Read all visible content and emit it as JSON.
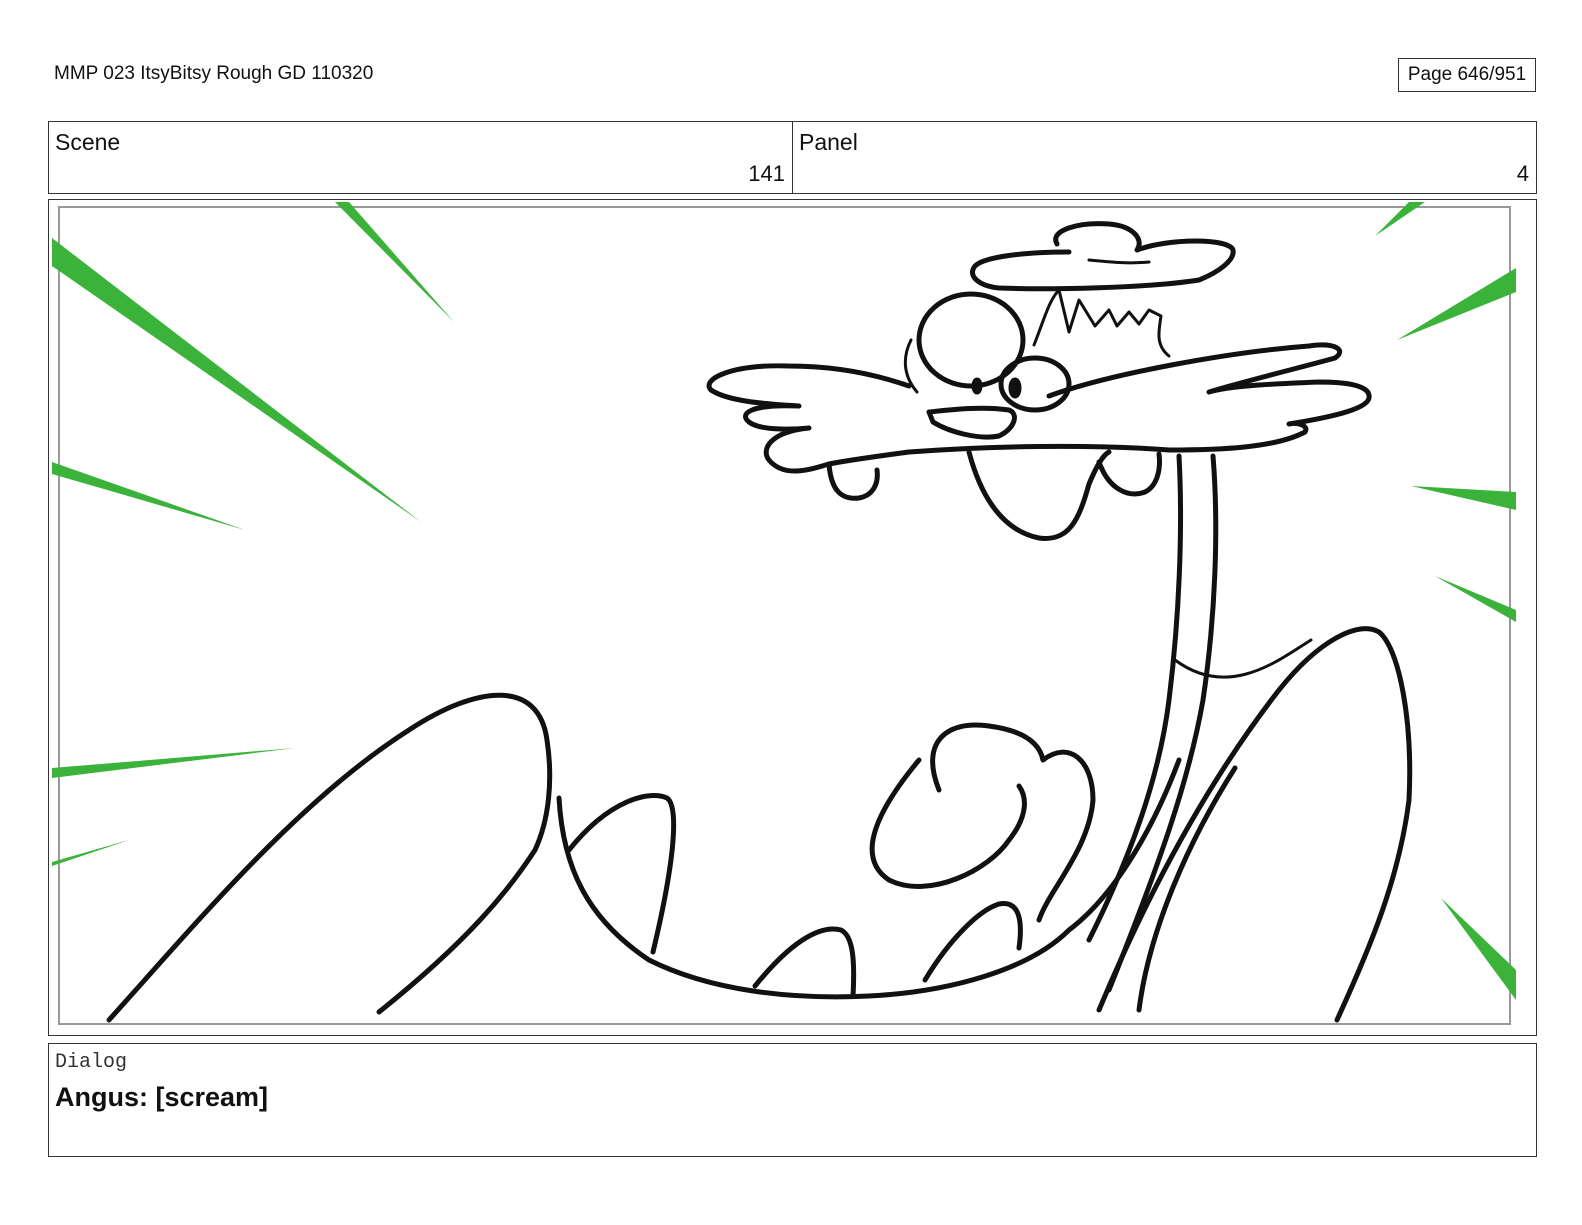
{
  "header": {
    "document_title": "MMP 023 ItsyBitsy Rough GD 110320",
    "page_label": "Page 646/951"
  },
  "info": {
    "scene_label": "Scene",
    "scene_value": "141",
    "panel_label": "Panel",
    "panel_value": "4"
  },
  "dialog": {
    "label": "Dialog",
    "text": "Angus: [scream]"
  },
  "colors": {
    "speed_lines": "#3bb33b",
    "ink": "#111111",
    "frame": "#999999"
  }
}
